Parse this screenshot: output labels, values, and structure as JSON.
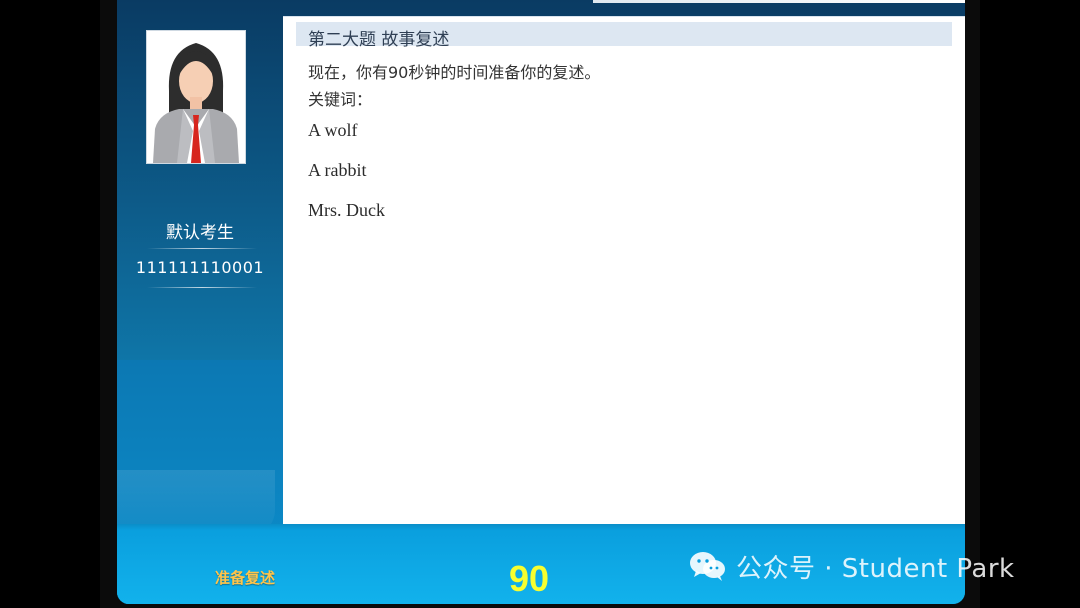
{
  "candidate": {
    "name": "默认考生",
    "id": "111111110001"
  },
  "section": {
    "title": "第二大题 故事复述",
    "instruction": "现在，你有90秒钟的时间准备你的复述。",
    "keywords_label": "关键词：",
    "keywords": [
      "A wolf",
      "A rabbit",
      "Mrs. Duck"
    ]
  },
  "footer": {
    "status_label": "准备复述",
    "countdown": "90"
  },
  "watermark": {
    "text": "公众号 · Student Park"
  },
  "colors": {
    "frame": "#0d5b89",
    "panel": "#ffffff",
    "header_bar": "#dde7f2",
    "status_label": "#ffc44a",
    "countdown": "#f7ff2f"
  },
  "icons": [
    "person-avatar-icon",
    "wechat-icon"
  ]
}
